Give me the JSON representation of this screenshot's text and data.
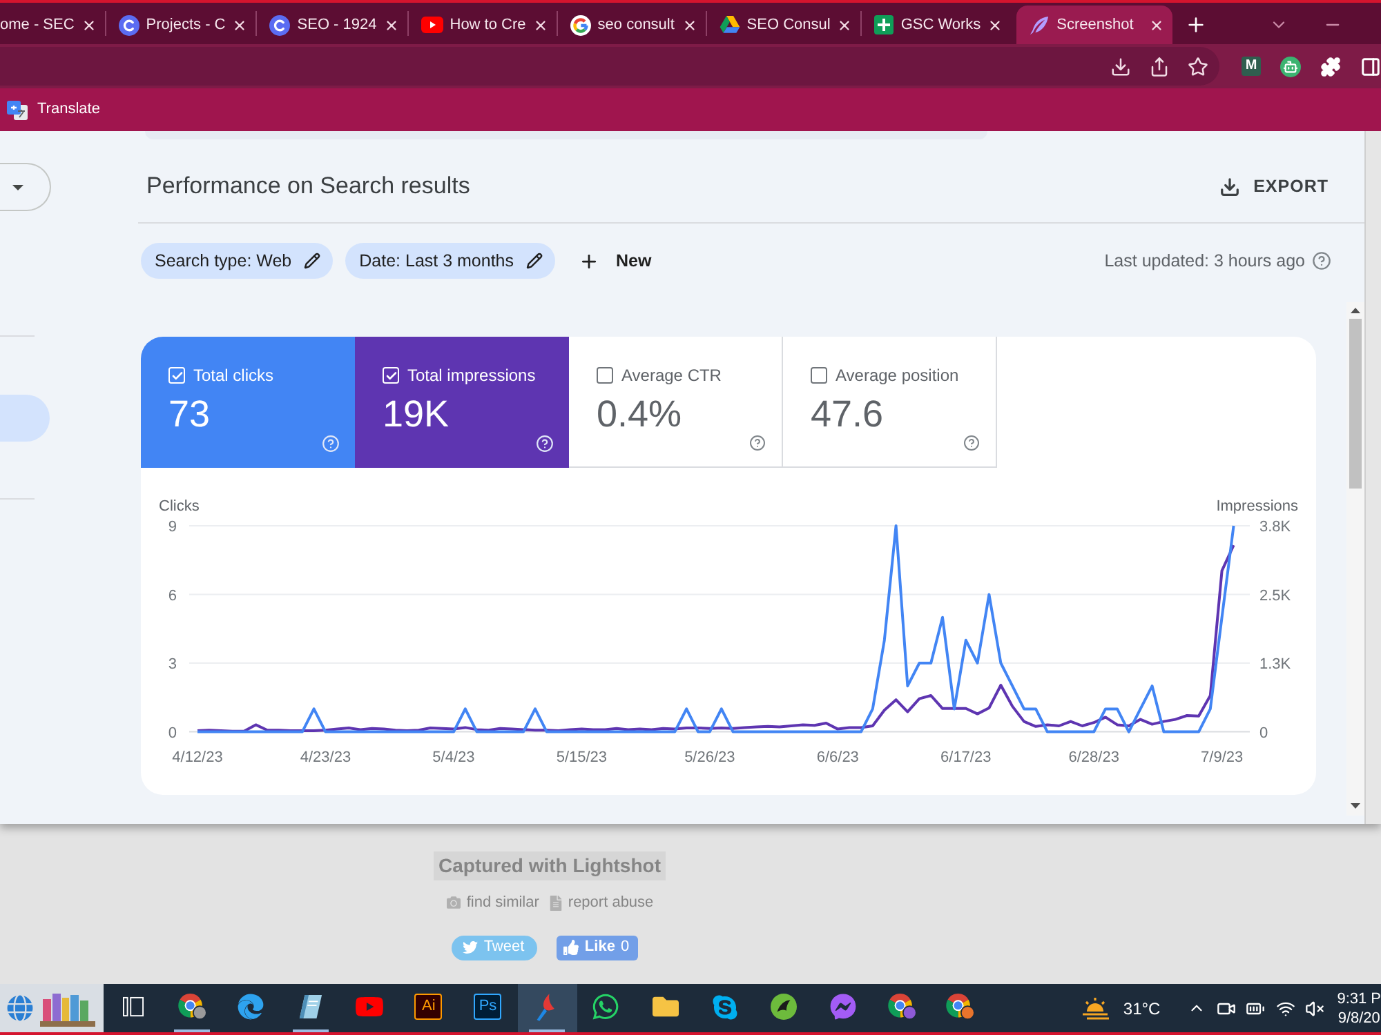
{
  "browser": {
    "tabs": [
      {
        "title": "ome - SEC",
        "kind": "none",
        "selected": false
      },
      {
        "title": "Projects - C",
        "kind": "c-circle",
        "selected": false
      },
      {
        "title": "SEO - 1924",
        "kind": "c-circle",
        "selected": false
      },
      {
        "title": "How to Cre",
        "kind": "play",
        "selected": false
      },
      {
        "title": "seo consult",
        "kind": "g-ring",
        "selected": false
      },
      {
        "title": "SEO Consul",
        "kind": "drive",
        "selected": false
      },
      {
        "title": "GSC Works",
        "kind": "sheet",
        "selected": false
      },
      {
        "title": "Screenshot",
        "kind": "feather",
        "selected": true
      }
    ],
    "extensions": [
      {
        "kind": "letter",
        "label": "M"
      },
      {
        "kind": "robot"
      },
      {
        "kind": "puzzle"
      },
      {
        "kind": "sidebar"
      }
    ],
    "bookmarks": [
      {
        "label": "Translate"
      }
    ]
  },
  "page": {
    "sidebar": {
      "items": [
        {
          "selected": true
        }
      ]
    },
    "title": "Performance on Search results",
    "export_label": "EXPORT",
    "filters": [
      {
        "label": "Search type: Web"
      },
      {
        "label": "Date: Last 3 months"
      }
    ],
    "new_filter_label": "New",
    "last_updated": "Last updated: 3 hours ago",
    "metrics": [
      {
        "label": "Total clicks",
        "value": "73",
        "checked": true,
        "color": "#4285f4"
      },
      {
        "label": "Total impressions",
        "value": "19K",
        "checked": true,
        "color": "#5e35b1"
      },
      {
        "label": "Average CTR",
        "value": "0.4%",
        "checked": false
      },
      {
        "label": "Average position",
        "value": "47.6",
        "checked": false
      }
    ],
    "chart_data": {
      "type": "line",
      "ylabel": "Clicks",
      "y2label": "Impressions",
      "ylim": [
        0,
        9
      ],
      "yticks": [
        0,
        3,
        6,
        9
      ],
      "y2lim": [
        0,
        3800
      ],
      "y2ticks": [
        {
          "value": 0,
          "label": "0"
        },
        {
          "value": 1267,
          "label": "1.3K"
        },
        {
          "value": 2533,
          "label": "2.5K"
        },
        {
          "value": 3800,
          "label": "3.8K"
        }
      ],
      "categories": [
        "4/12/23",
        null,
        null,
        null,
        null,
        null,
        null,
        null,
        null,
        null,
        null,
        "4/23/23",
        null,
        null,
        null,
        null,
        null,
        null,
        null,
        null,
        null,
        null,
        "5/4/23",
        null,
        null,
        null,
        null,
        null,
        null,
        null,
        null,
        null,
        null,
        "5/15/23",
        null,
        null,
        null,
        null,
        null,
        null,
        null,
        null,
        null,
        null,
        "5/26/23",
        null,
        null,
        null,
        null,
        null,
        null,
        null,
        null,
        null,
        null,
        "6/6/23",
        null,
        null,
        null,
        null,
        null,
        null,
        null,
        null,
        null,
        null,
        "6/17/23",
        null,
        null,
        null,
        null,
        null,
        null,
        null,
        null,
        null,
        null,
        "6/28/23",
        null,
        null,
        null,
        null,
        null,
        null,
        null,
        null,
        null,
        null,
        "7/9/23",
        null
      ],
      "series": [
        {
          "color": "#5e35b1",
          "axis": "y2",
          "values": [
            20,
            30,
            20,
            10,
            10,
            130,
            30,
            30,
            20,
            20,
            20,
            30,
            50,
            70,
            40,
            60,
            50,
            30,
            20,
            30,
            70,
            60,
            50,
            80,
            40,
            30,
            60,
            50,
            40,
            30,
            30,
            20,
            40,
            50,
            40,
            40,
            60,
            40,
            50,
            40,
            60,
            50,
            70,
            70,
            60,
            70,
            60,
            80,
            90,
            100,
            90,
            110,
            130,
            120,
            160,
            50,
            80,
            80,
            110,
            400,
            590,
            370,
            610,
            670,
            430,
            430,
            430,
            330,
            440,
            860,
            470,
            190,
            100,
            130,
            110,
            190,
            110,
            170,
            270,
            130,
            110,
            230,
            140,
            190,
            230,
            300,
            290,
            670,
            2970,
            3440
          ]
        },
        {
          "color": "#4285f4",
          "values": [
            0,
            0,
            0,
            0,
            0,
            0,
            0,
            0,
            0,
            0,
            1,
            0,
            0,
            0,
            0,
            0,
            0,
            0,
            0,
            0,
            0,
            0,
            0,
            1,
            0,
            0,
            0,
            0,
            0,
            1,
            0,
            0,
            0,
            0,
            0,
            0,
            0,
            0,
            0,
            0,
            0,
            0,
            1,
            0,
            0,
            1,
            0,
            0,
            0,
            0,
            0,
            0,
            0,
            0,
            0,
            0,
            0,
            0,
            1,
            4,
            9,
            2,
            3,
            3,
            5,
            1,
            4,
            3,
            6,
            3,
            2,
            1,
            1,
            0,
            0,
            0,
            0,
            0,
            1,
            1,
            0,
            1,
            2,
            0,
            0,
            0,
            0,
            1,
            5,
            9
          ]
        }
      ]
    }
  },
  "lightshot": {
    "caption": "Captured with Lightshot",
    "links": [
      {
        "kind": "camera",
        "label": "find similar"
      },
      {
        "kind": "document",
        "label": "report abuse"
      }
    ],
    "tweet_label": "Tweet",
    "like": {
      "label": "Like",
      "count": "0"
    }
  },
  "taskbar": {
    "apps": [
      {
        "kind": "task-view",
        "running": false,
        "selected": false
      },
      {
        "kind": "chrome-photo",
        "running": true,
        "selected": false
      },
      {
        "kind": "edge",
        "running": false,
        "selected": false
      },
      {
        "kind": "notebook",
        "running": true,
        "selected": false
      },
      {
        "kind": "youtube",
        "running": false,
        "selected": false
      },
      {
        "kind": "ai",
        "label": "Ai",
        "running": false,
        "selected": false
      },
      {
        "kind": "ps",
        "label": "Ps",
        "running": false,
        "selected": false
      },
      {
        "kind": "lightshot",
        "running": true,
        "selected": true
      },
      {
        "kind": "whatsapp",
        "running": false,
        "selected": false
      },
      {
        "kind": "explorer",
        "running": false,
        "selected": false
      },
      {
        "kind": "skype",
        "running": false,
        "selected": false
      },
      {
        "kind": "app",
        "running": false,
        "selected": false
      },
      {
        "kind": "messenger",
        "running": false,
        "selected": false
      },
      {
        "kind": "chrome-purple",
        "running": false,
        "selected": false
      },
      {
        "kind": "chrome-orange",
        "running": false,
        "selected": false
      }
    ],
    "weather": {
      "temperature": "31°C"
    },
    "clock": {
      "time": "9:31 P",
      "date": "9/8/20"
    }
  }
}
